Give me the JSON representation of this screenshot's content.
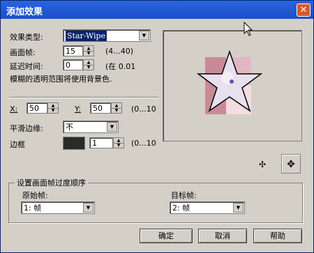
{
  "window": {
    "title": "添加效果",
    "close_glyph": "✕"
  },
  "effect_type": {
    "label": "效果类型:",
    "value": "Star-Wipe"
  },
  "frames": {
    "label": "画面帧:",
    "value": "15",
    "range": "(4...40)"
  },
  "delay": {
    "label": "延迟时间:",
    "value": "0",
    "range": "(在 0.01"
  },
  "note": "模糊的透明范围将使用背景色.",
  "x": {
    "label": "X:",
    "value": "50",
    "range": "(0...10"
  },
  "y": {
    "label": "Y:",
    "value": "50",
    "range": "(0...10"
  },
  "smooth_edge": {
    "label": "平滑边缘:",
    "value": "不"
  },
  "border": {
    "label": "边框",
    "color": "#2b2b2b",
    "value": "1",
    "range": "(0...10"
  },
  "order": {
    "legend": "设置画面帧过度顺序",
    "source_label": "原始帧:",
    "source_value": "1: 帧",
    "target_label": "目标帧:",
    "target_value": "2: 帧"
  },
  "buttons": {
    "ok": "确定",
    "cancel": "取消",
    "help": "帮助"
  },
  "colors": {
    "titlebar": "#1a4fc8",
    "dialog": "#d4d0c8",
    "close": "#d8592a"
  }
}
